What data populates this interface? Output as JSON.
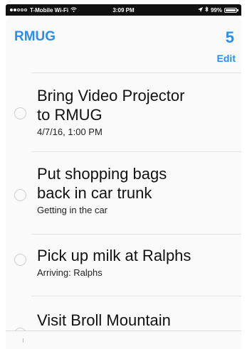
{
  "status_bar": {
    "carrier": "T-Mobile Wi-Fi",
    "wifi_icon": "wifi-icon",
    "time": "3:09 PM",
    "location_icon": "location-arrow-icon",
    "bluetooth_icon": "bluetooth-icon",
    "battery_text": "99%",
    "battery_level": 0.99
  },
  "header": {
    "title": "RMUG",
    "count": "5",
    "edit_label": "Edit"
  },
  "colors": {
    "accent": "#2b8df0",
    "text": "#111111"
  },
  "reminders": [
    {
      "title_lines": [
        "Bring Video Projector",
        "to RMUG"
      ],
      "subtitle": "4/7/16, 1:00 PM"
    },
    {
      "title_lines": [
        "Put shopping bags",
        "back in car trunk"
      ],
      "subtitle": "Getting in the car"
    },
    {
      "title_lines": [
        "Pick up milk at Ralphs"
      ],
      "subtitle": "Arriving: Ralphs"
    },
    {
      "title_lines": [
        "Visit Broll Mountain"
      ],
      "subtitle": ""
    }
  ]
}
